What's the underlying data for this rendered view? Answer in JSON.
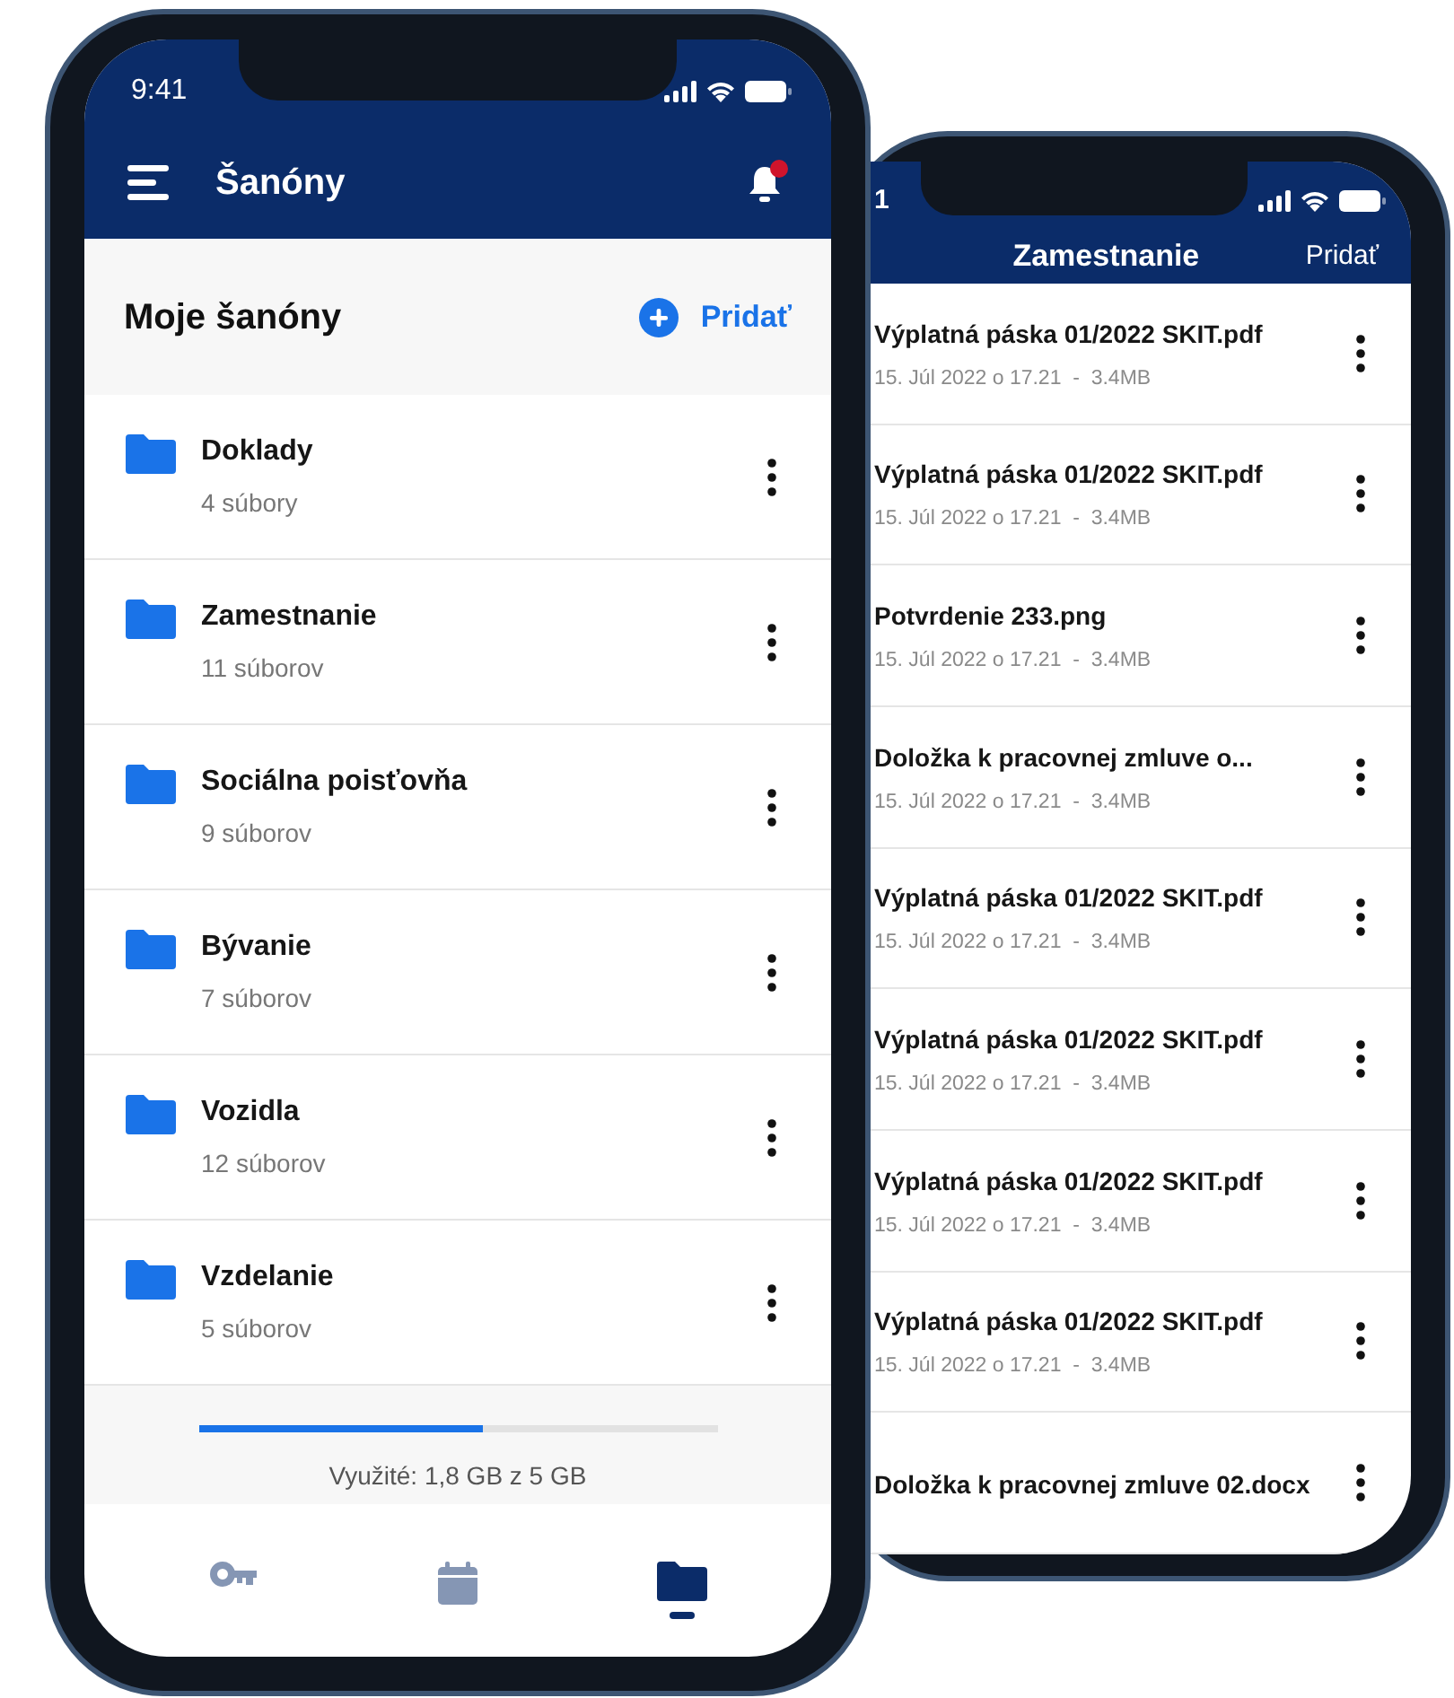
{
  "front_phone": {
    "status_time": "9:41",
    "title": "Šanóny",
    "notifications_unread": true,
    "section_title": "Moje šanóny",
    "add_label": "Pridať",
    "folders": [
      {
        "name": "Doklady",
        "count": "4 súbory"
      },
      {
        "name": "Zamestnanie",
        "count": "11 súborov"
      },
      {
        "name": "Sociálna poisťovňa",
        "count": "9 súborov"
      },
      {
        "name": "Bývanie",
        "count": "7 súborov"
      },
      {
        "name": "Vozidla",
        "count": "12 súborov"
      },
      {
        "name": "Vzdelanie",
        "count": "5 súborov"
      }
    ],
    "storage": {
      "level": 0.55,
      "label": "Využité: 1,8 GB z 5 GB"
    },
    "nav": [
      {
        "kind": "key",
        "selected": false
      },
      {
        "kind": "calendar",
        "selected": false
      },
      {
        "kind": "folder",
        "selected": true
      }
    ]
  },
  "back_phone": {
    "status_time": "1",
    "title": "Zamestnanie",
    "add_label": "Pridať",
    "files": [
      {
        "name": "Výplatná páska 01/2022 SKIT.pdf",
        "meta": "15. Júl 2022 o 17.21  -  3.4MB"
      },
      {
        "name": "Výplatná páska 01/2022 SKIT.pdf",
        "meta": "15. Júl 2022 o 17.21  -  3.4MB"
      },
      {
        "name": "Potvrdenie 233.png",
        "meta": "15. Júl 2022 o 17.21  -  3.4MB"
      },
      {
        "name": "Doložka k pracovnej zmluve o...",
        "meta": "15. Júl 2022 o 17.21  -  3.4MB"
      },
      {
        "name": "Výplatná páska 01/2022 SKIT.pdf",
        "meta": "15. Júl 2022 o 17.21  -  3.4MB"
      },
      {
        "name": "Výplatná páska 01/2022 SKIT.pdf",
        "meta": "15. Júl 2022 o 17.21  -  3.4MB"
      },
      {
        "name": "Výplatná páska 01/2022 SKIT.pdf",
        "meta": "15. Júl 2022 o 17.21  -  3.4MB"
      },
      {
        "name": "Výplatná páska 01/2022 SKIT.pdf",
        "meta": "15. Júl 2022 o 17.21  -  3.4MB"
      },
      {
        "name": "Doložka k pracovnej zmluve 02.docx"
      }
    ]
  }
}
